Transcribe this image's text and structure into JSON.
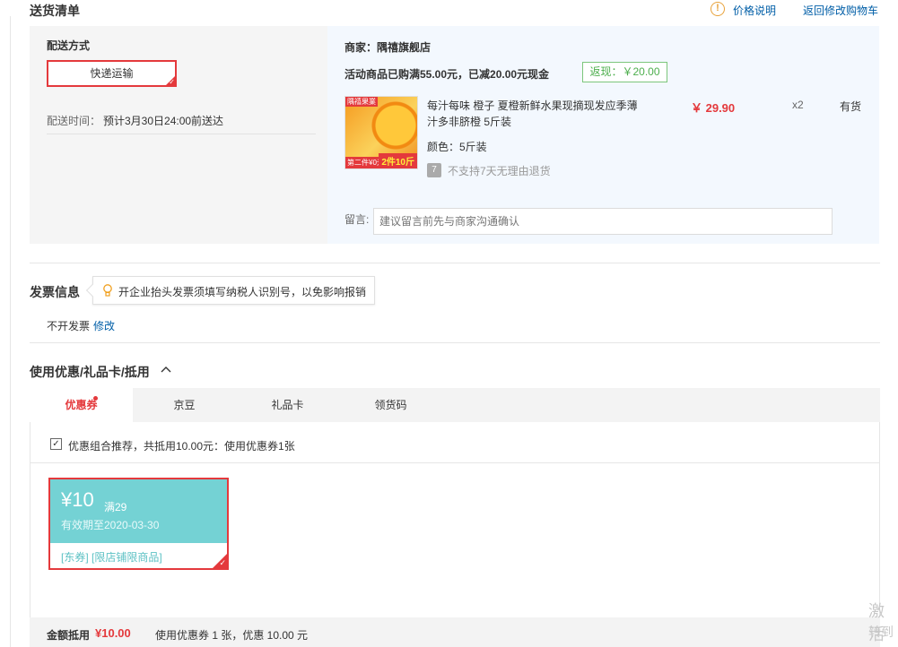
{
  "header": {
    "title": "送货清单",
    "price_info_link": "价格说明",
    "back_to_cart_link": "返回修改购物车"
  },
  "shipping": {
    "method_label": "配送方式",
    "method_value": "快递运输",
    "time_label": "配送时间：",
    "time_value": "预计3月30日24:00前送达"
  },
  "order": {
    "merchant": "商家：隅禧旗舰店",
    "promo_text": "活动商品已购满55.00元，已减20.00元现金",
    "rebate": "返现：￥20.00",
    "product": {
      "image_badge": "隅禧果業",
      "image_tag_left": "第二件¥0元",
      "image_tag_right": "2件10斤",
      "name": "每汁每味 橙子 夏橙新鲜水果现摘现发应季薄汁多非脐橙 5斤装",
      "color_label": "颜色：5斤装",
      "price": "￥ 29.90",
      "quantity": "x2",
      "stock": "有货",
      "return_icon": "7",
      "return_policy": "不支持7天无理由退货"
    },
    "remark_label": "留言:",
    "remark_placeholder": "建议留言前先与商家沟通确认"
  },
  "invoice": {
    "title": "发票信息",
    "tip": "开企业抬头发票须填写纳税人识别号，以免影响报销",
    "status": "不开发票",
    "edit_link": "修改"
  },
  "coupons": {
    "title": "使用优惠/礼品卡/抵用",
    "tabs": [
      "优惠券",
      "京豆",
      "礼品卡",
      "领货码"
    ],
    "recommend_text": "优惠组合推荐，共抵用10.00元：使用优惠券1张",
    "coupon": {
      "amount": "¥10",
      "condition": "满29",
      "validity": "有效期至2020-03-30",
      "tags": "[东券] [限店铺限商品]"
    }
  },
  "summary": {
    "label": "金额抵用",
    "amount": "¥10.00",
    "detail": "使用优惠券 1 张，优惠 10.00 元"
  },
  "watermark": {
    "line1": "激活",
    "line2": "转到"
  },
  "colors": {
    "accent_red": "#e4393c",
    "link_blue": "#005ea7",
    "coupon_teal": "#74d2d4",
    "rebate_green": "#4cae4c"
  }
}
